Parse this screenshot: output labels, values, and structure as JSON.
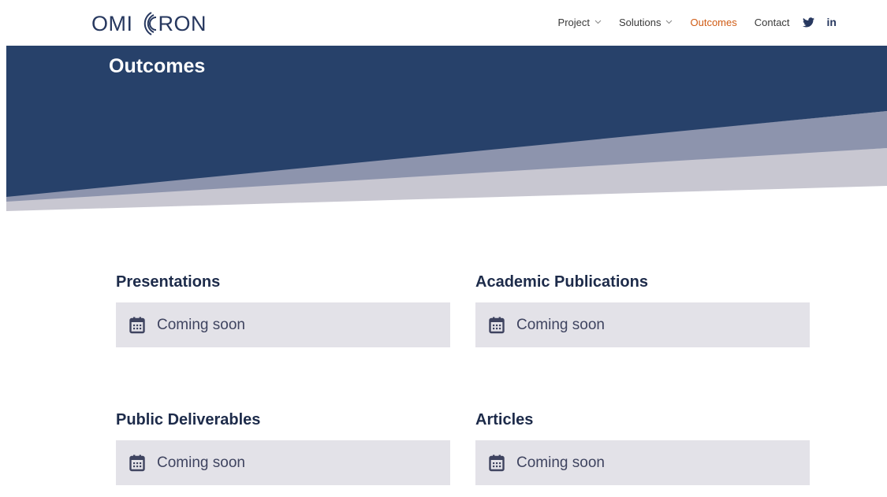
{
  "brand": {
    "name_left": "OMI",
    "name_right": "RON",
    "logo_icon": "signal-waves-icon",
    "color": "#27385f"
  },
  "nav": {
    "items": [
      {
        "label": "Project",
        "has_dropdown": true
      },
      {
        "label": "Solutions",
        "has_dropdown": true
      },
      {
        "label": "Outcomes",
        "has_dropdown": false,
        "active": true
      },
      {
        "label": "Contact",
        "has_dropdown": false
      }
    ],
    "social": [
      {
        "icon": "twitter-icon"
      },
      {
        "icon": "linkedin-icon",
        "text": "in"
      }
    ],
    "active_color": "#d05b14"
  },
  "hero": {
    "title": "Outcomes",
    "colors": {
      "dark": "#27416a",
      "mid": "#8d94ad",
      "light": "#c8c7d1"
    }
  },
  "sections": [
    {
      "title": "Presentations",
      "status": "Coming soon",
      "icon": "calendar-icon"
    },
    {
      "title": "Academic Publications",
      "status": "Coming soon",
      "icon": "calendar-icon"
    },
    {
      "title": "Public Deliverables",
      "status": "Coming soon",
      "icon": "calendar-icon"
    },
    {
      "title": "Articles",
      "status": "Coming soon",
      "icon": "calendar-icon"
    }
  ]
}
